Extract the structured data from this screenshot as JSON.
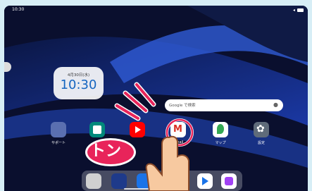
{
  "status": {
    "time": "10:30",
    "battery": "battery-icon"
  },
  "clock": {
    "date": "4月30日(水)",
    "time": "10:30"
  },
  "search": {
    "placeholder": "Google で検索",
    "mic_icon": "mic-icon"
  },
  "home_apps": [
    {
      "name": "サポート",
      "icon": "support-icon",
      "color": "#5a6fb0"
    },
    {
      "name": "",
      "icon": "meet-icon",
      "color": "#00897b"
    },
    {
      "name": "",
      "icon": "youtube-icon",
      "color": "#ff0000"
    },
    {
      "name": "Gmail",
      "icon": "gmail-icon",
      "color": "#ffffff"
    },
    {
      "name": "マップ",
      "icon": "maps-icon",
      "color": "#ffffff"
    },
    {
      "name": "設定",
      "icon": "settings-icon",
      "color": "#5f6b7a"
    }
  ],
  "dock_apps": [
    {
      "icon": "folder-icon",
      "color": "#d0d0d0"
    },
    {
      "icon": "app-icon",
      "color": "#1e3a8a"
    },
    {
      "icon": "messages-icon",
      "color": "#1a73e8"
    },
    {
      "icon": "chrome-icon",
      "color": "#ffffff"
    },
    {
      "icon": "play-store-icon",
      "color": "#ffffff"
    },
    {
      "icon": "app-drawer-icon",
      "color": "#ffffff"
    }
  ],
  "annotation": {
    "text": "トン",
    "color": "#e8245a"
  },
  "colors": {
    "wallpaper": "#0a0f2e",
    "accent": "#1565c0",
    "frame": "#d7eef6"
  }
}
